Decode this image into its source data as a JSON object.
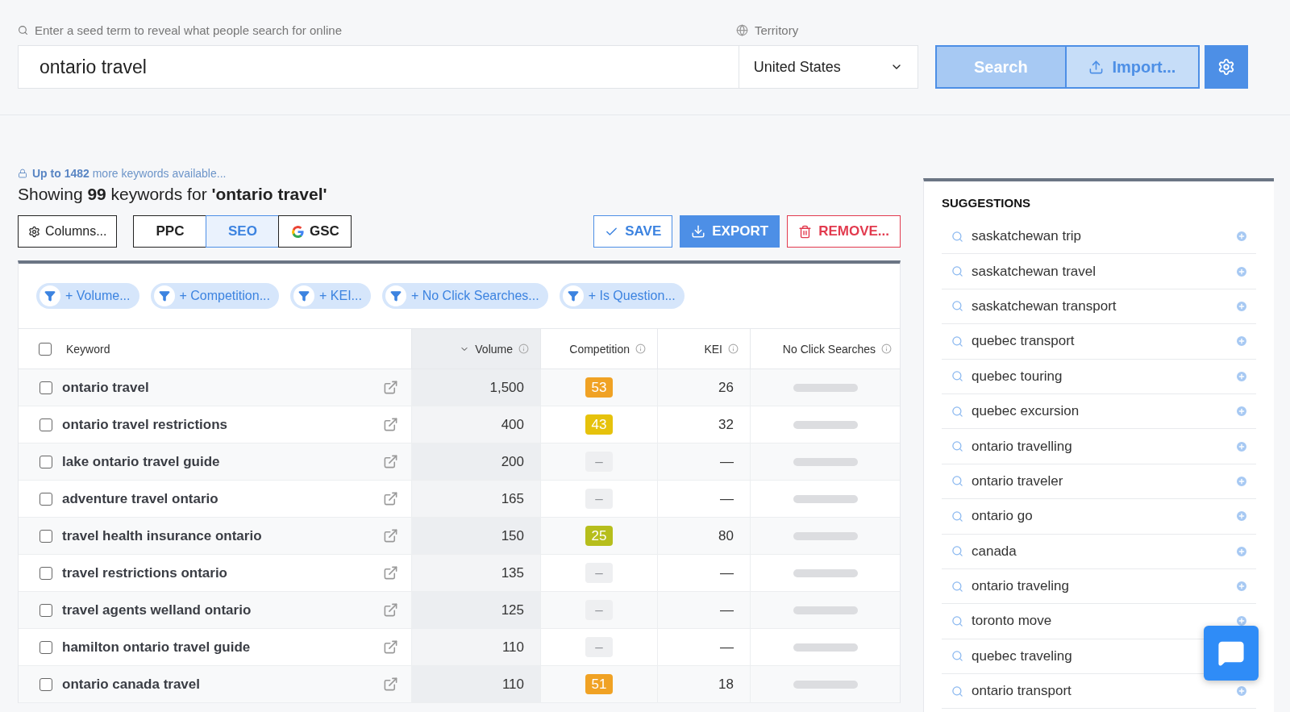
{
  "search": {
    "label": "Enter a seed term to reveal what people search for online",
    "value": "ontario travel"
  },
  "territory": {
    "label": "Territory",
    "value": "United States"
  },
  "actions": {
    "search": "Search",
    "import": "Import..."
  },
  "notice": {
    "text": "**Up to 1482** more keywords available..."
  },
  "heading": "Showing **99** keywords for **'ontario travel'**",
  "columns_button": "Columns...",
  "tabs": [
    {
      "label": "PPC",
      "selected": false
    },
    {
      "label": "SEO",
      "selected": true
    },
    {
      "label": "GSC",
      "selected": false
    }
  ],
  "buttons": [
    {
      "kind": "save",
      "label": "SAVE"
    },
    {
      "kind": "export",
      "label": "EXPORT"
    },
    {
      "kind": "remove",
      "label": "REMOVE..."
    }
  ],
  "filters": [
    "+ Volume...",
    "+ Competition...",
    "+ KEI...",
    "+ No Click Searches...",
    "+ Is Question..."
  ],
  "table": {
    "select_all_checked": false,
    "columns": [
      {
        "label": "Keyword",
        "sorted": false
      },
      {
        "label": "Volume",
        "sorted": true
      },
      {
        "label": "Competition",
        "sorted": false
      },
      {
        "label": "KEI",
        "sorted": false
      },
      {
        "label": "No Click Searches",
        "sorted": false
      }
    ],
    "rows": [
      {
        "keyword": "ontario travel",
        "checked": false,
        "volume": "1,500",
        "competition": "53",
        "color": "#f0a224",
        "kei": "26"
      },
      {
        "keyword": "ontario travel restrictions",
        "checked": false,
        "volume": "400",
        "competition": "43",
        "color": "#e6c20c",
        "kei": "32"
      },
      {
        "keyword": "lake ontario travel guide",
        "checked": false,
        "volume": "200",
        "competition": "–",
        "color": "#eeeff1",
        "kei": "—"
      },
      {
        "keyword": "adventure travel ontario",
        "checked": false,
        "volume": "165",
        "competition": "–",
        "color": "#eeeff1",
        "kei": "—"
      },
      {
        "keyword": "travel health insurance ontario",
        "checked": false,
        "volume": "150",
        "competition": "25",
        "color": "#b6be1c",
        "kei": "80"
      },
      {
        "keyword": "travel restrictions ontario",
        "checked": false,
        "volume": "135",
        "competition": "–",
        "color": "#eeeff1",
        "kei": "—"
      },
      {
        "keyword": "travel agents welland ontario",
        "checked": false,
        "volume": "125",
        "competition": "–",
        "color": "#eeeff1",
        "kei": "—"
      },
      {
        "keyword": "hamilton ontario travel guide",
        "checked": false,
        "volume": "110",
        "competition": "–",
        "color": "#eeeff1",
        "kei": "—"
      },
      {
        "keyword": "ontario canada travel",
        "checked": false,
        "volume": "110",
        "competition": "51",
        "color": "#f0a224",
        "kei": "18"
      }
    ]
  },
  "suggestions": {
    "title": "SUGGESTIONS",
    "items": [
      "saskatchewan trip",
      "saskatchewan travel",
      "saskatchewan transport",
      "quebec transport",
      "quebec touring",
      "quebec excursion",
      "ontario travelling",
      "ontario traveler",
      "ontario go",
      "canada",
      "ontario traveling",
      "toronto move",
      "quebec traveling",
      "ontario transport"
    ]
  }
}
